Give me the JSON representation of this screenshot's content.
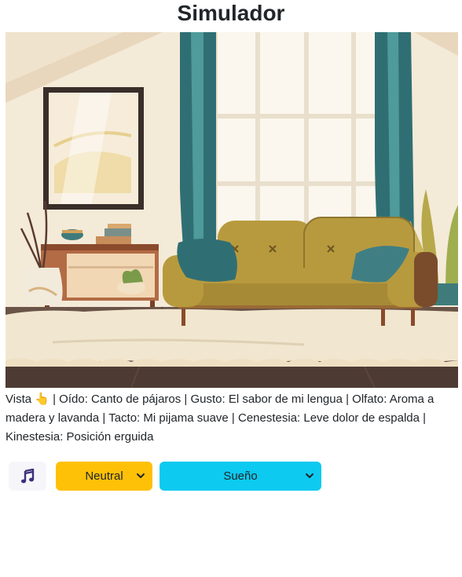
{
  "page": {
    "title": "Simulador"
  },
  "scene": {
    "image_alt": "living room scene"
  },
  "description": {
    "vista_label": "Vista",
    "hand_emoji": "👆",
    "text": " | Oído: Canto de pájaros | Gusto: El sabor de mi lengua | Olfato: Aroma a madera y lavanda | Tacto: Mi pijama suave | Cenestesia: Leve dolor de espalda | Kinestesia: Posición erguida"
  },
  "controls": {
    "music_icon": "music-note-icon",
    "mood_select": {
      "selected": "Neutral"
    },
    "state_select": {
      "selected": "Sueño"
    }
  },
  "colors": {
    "mood_select_bg": "#ffc107",
    "state_select_bg": "#0dcaf0",
    "music_icon": "#3d2f7a"
  }
}
